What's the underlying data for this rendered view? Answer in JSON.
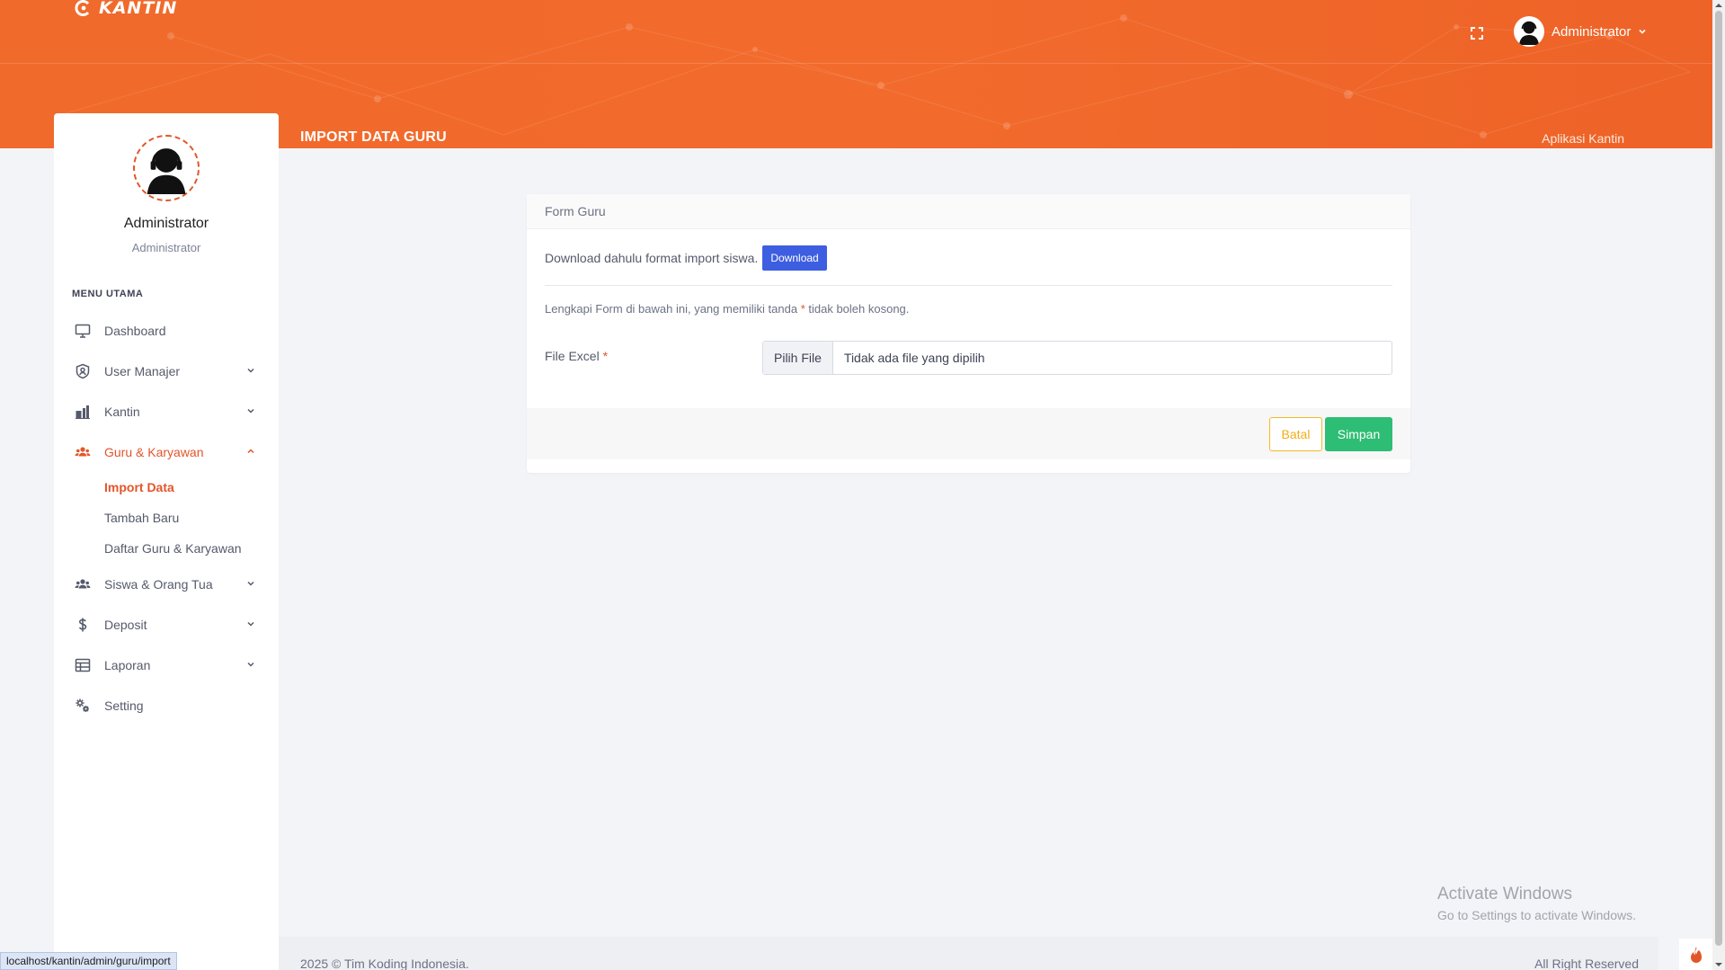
{
  "header": {
    "brand": "KANTIN",
    "user_name": "Administrator",
    "page_title": "IMPORT DATA GURU",
    "app_name": "Aplikasi Kantin"
  },
  "sidebar": {
    "profile": {
      "name": "Administrator",
      "role": "Administrator"
    },
    "menu_heading": "MENU UTAMA",
    "items": [
      {
        "label": "Dashboard",
        "icon": "monitor-icon"
      },
      {
        "label": "User Manajer",
        "icon": "shield-user-icon"
      },
      {
        "label": "Kantin",
        "icon": "store-icon"
      },
      {
        "label": "Guru & Karyawan",
        "icon": "users-icon",
        "expanded": true
      },
      {
        "label": "Siswa & Orang Tua",
        "icon": "users-icon"
      },
      {
        "label": "Deposit",
        "icon": "dollar-icon"
      },
      {
        "label": "Laporan",
        "icon": "table-icon"
      },
      {
        "label": "Setting",
        "icon": "gears-icon"
      }
    ],
    "submenu": [
      "Import Data",
      "Tambah Baru",
      "Daftar Guru & Karyawan"
    ]
  },
  "form": {
    "card_title": "Form Guru",
    "download_text": "Download dahulu format import siswa.",
    "download_button": "Download",
    "hint_before": "Lengkapi Form di bawah ini, yang memiliki tanda ",
    "hint_mark": "*",
    "hint_after": " tidak boleh kosong.",
    "file_label": "File Excel",
    "required_mark": "*",
    "file_button": "Pilih File",
    "file_status": "Tidak ada file yang dipilih",
    "cancel_button": "Batal",
    "save_button": "Simpan"
  },
  "footer": {
    "copyright": "2025 © Tim Koding Indonesia.",
    "rights": "All Right Reserved"
  },
  "watermark": {
    "title": "Activate Windows",
    "subtitle": "Go to Settings to activate Windows."
  },
  "status_url": "localhost/kantin/admin/guru/import",
  "colors": {
    "header": "#f06a2b",
    "accent": "#e2552a",
    "download": "#3d5ee1",
    "save": "#2ebd74",
    "cancel": "#f5b927"
  }
}
